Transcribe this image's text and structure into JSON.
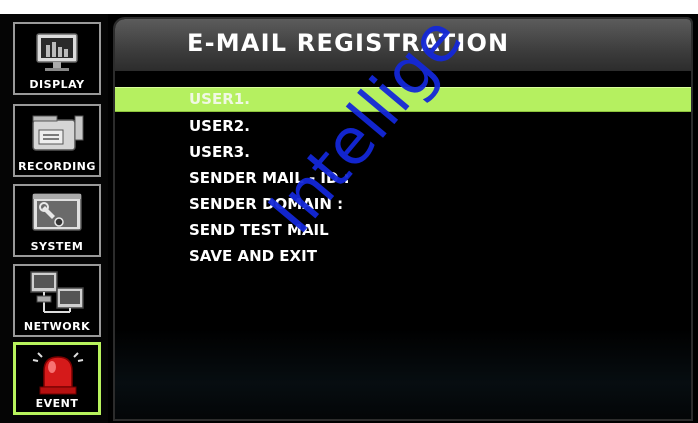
{
  "sidebar": {
    "items": [
      {
        "label": "DISPLAY",
        "icon": "display-monitor-icon"
      },
      {
        "label": "RECORDING",
        "icon": "video-camera-icon"
      },
      {
        "label": "SYSTEM",
        "icon": "wrench-system-icon"
      },
      {
        "label": "NETWORK",
        "icon": "network-computers-icon"
      },
      {
        "label": "EVENT",
        "icon": "alarm-siren-icon",
        "active": true
      }
    ]
  },
  "main": {
    "title": "E-MAIL REGISTRATION",
    "menu": [
      {
        "label": "USER1.",
        "selected": true
      },
      {
        "label": "USER2."
      },
      {
        "label": "USER3."
      },
      {
        "label": "SENDER MAIL - ID :"
      },
      {
        "label": "SENDER DOMAIN  :"
      },
      {
        "label": "SEND TEST MAIL"
      },
      {
        "label": "SAVE AND EXIT"
      }
    ]
  },
  "watermark": {
    "text": "Intellige"
  },
  "colors": {
    "selection": "#b5f060",
    "active_border": "#b8f35d",
    "background": "#000000",
    "watermark": "#1428d8"
  }
}
